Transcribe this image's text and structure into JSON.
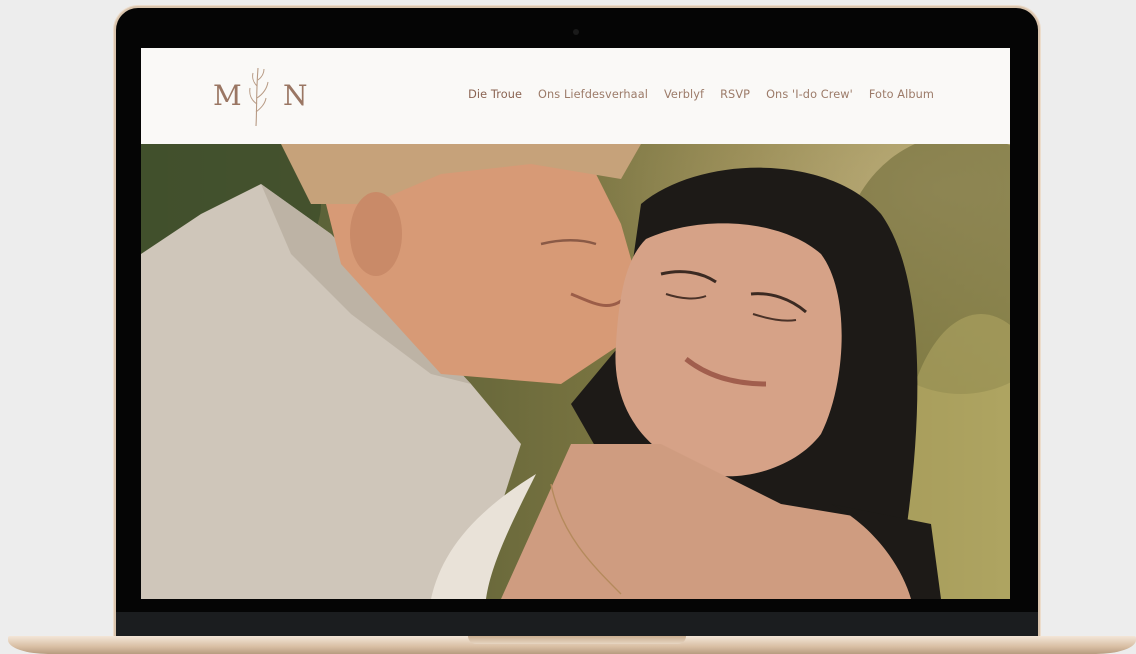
{
  "site": {
    "logo": {
      "left_initial": "M",
      "right_initial": "N"
    },
    "nav": [
      {
        "label": "Die Troue",
        "active": true
      },
      {
        "label": "Ons Liefdesverhaal"
      },
      {
        "label": "Verblyf"
      },
      {
        "label": "RSVP"
      },
      {
        "label": "Ons 'I-do Crew'"
      },
      {
        "label": "Foto Album"
      }
    ]
  },
  "colors": {
    "nav_text": "#9c7b69",
    "logo": "#9a7663",
    "laptop_frame": "#d9c4ad"
  }
}
